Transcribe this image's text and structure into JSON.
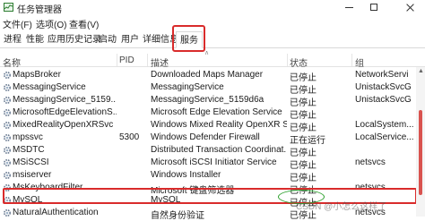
{
  "window": {
    "title": "任务管理器"
  },
  "menu": [
    "文件(F)",
    "选项(O)",
    "查看(V)"
  ],
  "tabs": [
    "进程",
    "性能",
    "应用历史记录",
    "启动",
    "用户",
    "详细信息",
    "服务"
  ],
  "active_tab": "服务",
  "columns": {
    "name": "名称",
    "pid": "PID",
    "desc": "描述",
    "status": "状态",
    "group": "组"
  },
  "rows": [
    {
      "name": "MapsBroker",
      "pid": "",
      "desc": "Downloaded Maps Manager",
      "status": "已停止",
      "group": "NetworkServi"
    },
    {
      "name": "MessagingService",
      "pid": "",
      "desc": "MessagingService",
      "status": "已停止",
      "group": "UnistackSvcG"
    },
    {
      "name": "MessagingService_5159...",
      "pid": "",
      "desc": "MessagingService_5159d6a",
      "status": "已停止",
      "group": "UnistackSvcG"
    },
    {
      "name": "MicrosoftEdgeElevationS...",
      "pid": "",
      "desc": "Microsoft Edge Elevation Service",
      "status": "已停止",
      "group": ""
    },
    {
      "name": "MixedRealityOpenXRSvc",
      "pid": "",
      "desc": "Windows Mixed Reality OpenXR S...",
      "status": "已停止",
      "group": "LocalSystem..."
    },
    {
      "name": "mpssvc",
      "pid": "5300",
      "desc": "Windows Defender Firewall",
      "status": "正在运行",
      "group": "LocalService..."
    },
    {
      "name": "MSDTC",
      "pid": "",
      "desc": "Distributed Transaction Coordinat...",
      "status": "已停止",
      "group": ""
    },
    {
      "name": "MSiSCSI",
      "pid": "",
      "desc": "Microsoft iSCSI Initiator Service",
      "status": "已停止",
      "group": "netsvcs"
    },
    {
      "name": "msiserver",
      "pid": "",
      "desc": "Windows Installer",
      "status": "已停止",
      "group": ""
    },
    {
      "name": "MsKeyboardFilter",
      "pid": "",
      "desc": "Microsoft 键盘筛选器",
      "status": "已停止",
      "group": "netsvcs"
    },
    {
      "name": "MySQL",
      "pid": "",
      "desc": "MySQL",
      "status": "已停止",
      "group": ""
    },
    {
      "name": "NaturalAuthentication",
      "pid": "",
      "desc": "自然身份验证",
      "status": "已停止",
      "group": "netsvcs"
    }
  ],
  "watermark": "CSDN @小怎么这样了",
  "colors": {
    "highlight_red": "#d92b2b",
    "oval_green": "#2ca02c",
    "scroll_thumb": "#d9534f"
  }
}
